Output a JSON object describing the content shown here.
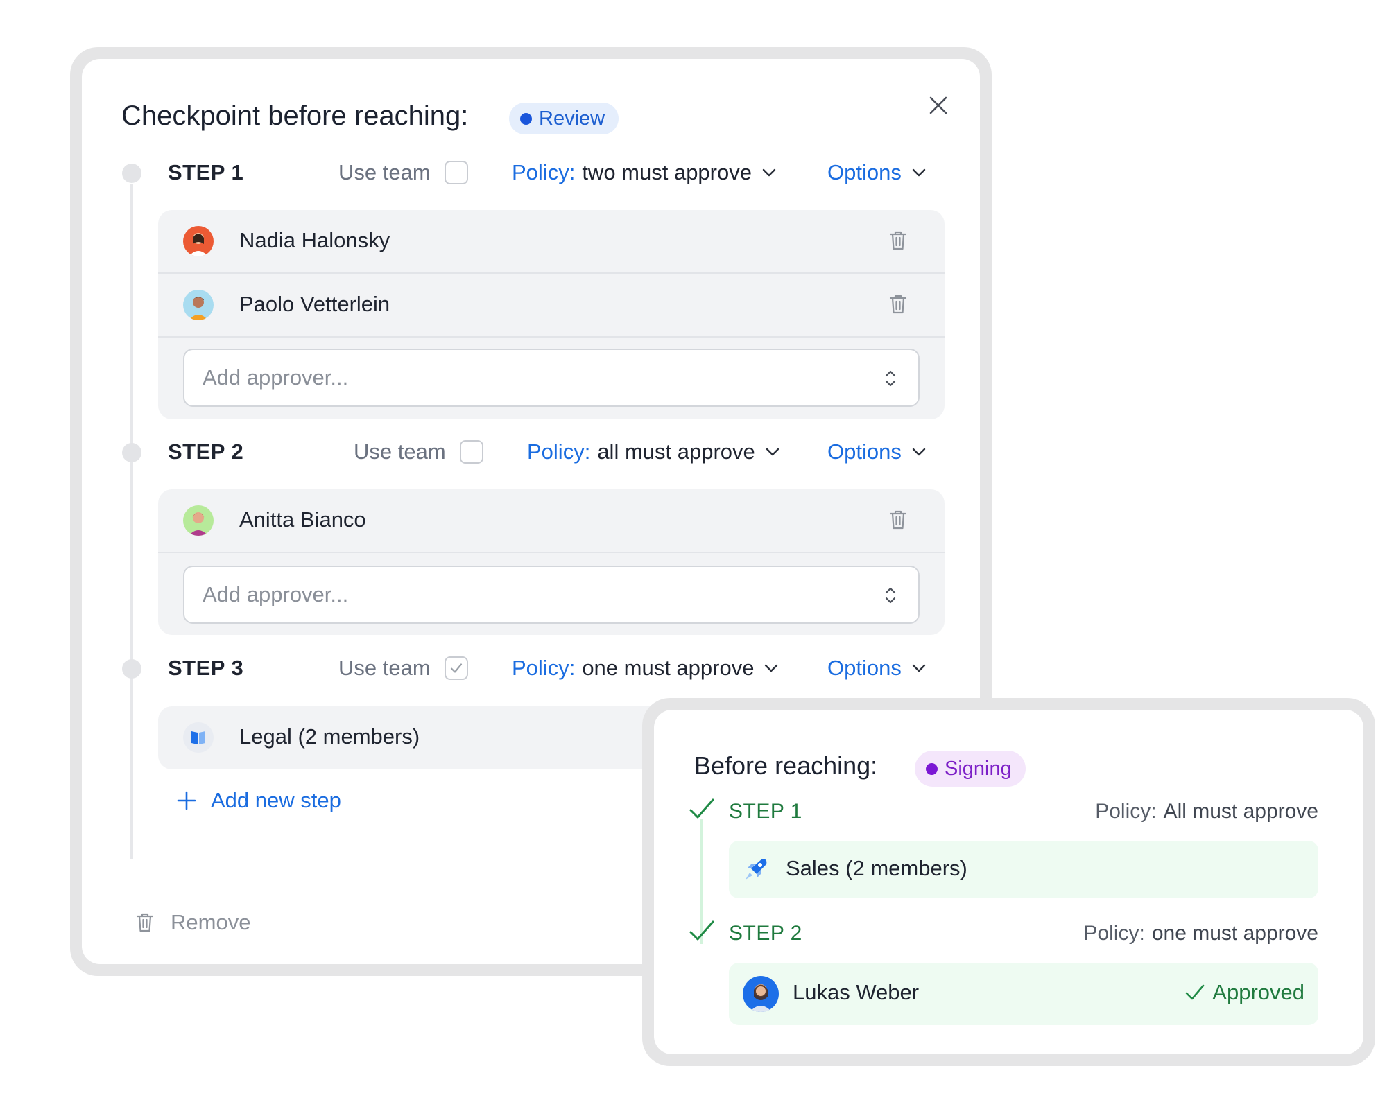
{
  "checkpoint": {
    "title": "Checkpoint before reaching:",
    "stage_chip": "Review",
    "steps": [
      {
        "label": "STEP 1",
        "use_team_label": "Use team",
        "use_team_checked": false,
        "policy_key": "Policy:",
        "policy_value": "two must approve",
        "options_label": "Options",
        "approvers": [
          {
            "name": "Nadia Halonsky"
          },
          {
            "name": "Paolo Vetterlein"
          }
        ],
        "add_placeholder": "Add approver..."
      },
      {
        "label": "STEP 2",
        "use_team_label": "Use team",
        "use_team_checked": false,
        "policy_key": "Policy:",
        "policy_value": "all must approve",
        "options_label": "Options",
        "approvers": [
          {
            "name": "Anitta Bianco"
          }
        ],
        "add_placeholder": "Add approver..."
      },
      {
        "label": "STEP 3",
        "use_team_label": "Use team",
        "use_team_checked": true,
        "policy_key": "Policy:",
        "policy_value": "one must approve",
        "options_label": "Options",
        "team": {
          "name": "Legal (2 members)"
        }
      }
    ],
    "add_step_label": "Add new step",
    "remove_label": "Remove"
  },
  "summary": {
    "title": "Before reaching:",
    "stage_chip": "Signing",
    "steps": [
      {
        "label": "STEP 1",
        "policy_key": "Policy:",
        "policy_value": "All must approve",
        "member": "Sales (2 members)"
      },
      {
        "label": "STEP 2",
        "policy_key": "Policy:",
        "policy_value": "one must approve",
        "member": "Lukas Weber",
        "status": "Approved"
      }
    ]
  },
  "colors": {
    "accent_blue": "#1a6ce0",
    "review_chip_bg": "#e5eefc",
    "signing_chip_bg": "#f4e6fb",
    "signing_purple": "#7b18d4",
    "approved_green": "#1f7a3e",
    "approved_row_bg": "#eefbf2",
    "panel_bg": "#f2f3f5"
  },
  "icons": {
    "close": "close-icon",
    "chevron": "chevron-down-icon",
    "trash": "trash-icon",
    "select": "chevron-up-down-icon",
    "add": "plus-icon",
    "check": "check-icon",
    "team_legal": "book-icon",
    "team_sales": "rocket-icon"
  }
}
